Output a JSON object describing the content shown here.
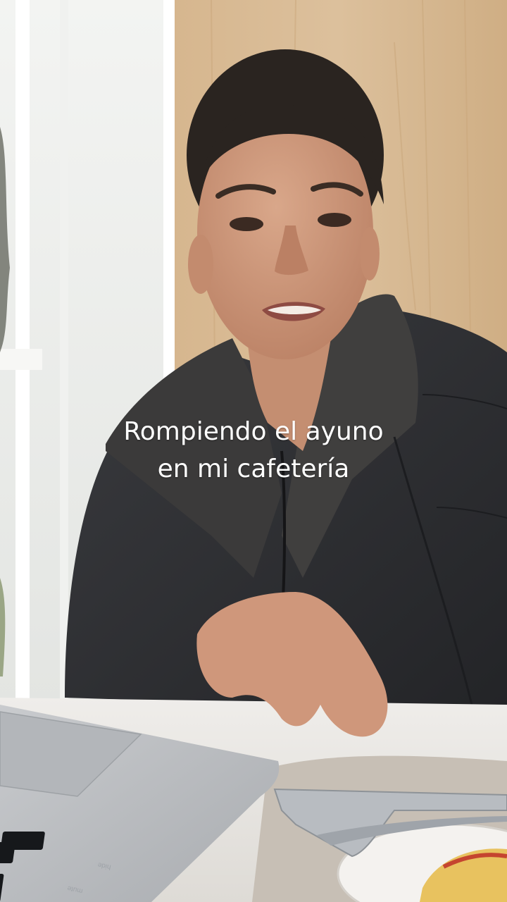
{
  "caption": {
    "line1": "Rompiendo el ayuno",
    "line2": "en mi cafetería"
  },
  "laptop_keys": {
    "key_a": "mute",
    "key_b": "hide"
  },
  "colors": {
    "caption_text": "#ffffff",
    "wood_wall": "#d8b992",
    "jacket": "#2c2d30",
    "table": "#ebe9e6",
    "laptop": "#bcbfc3"
  }
}
